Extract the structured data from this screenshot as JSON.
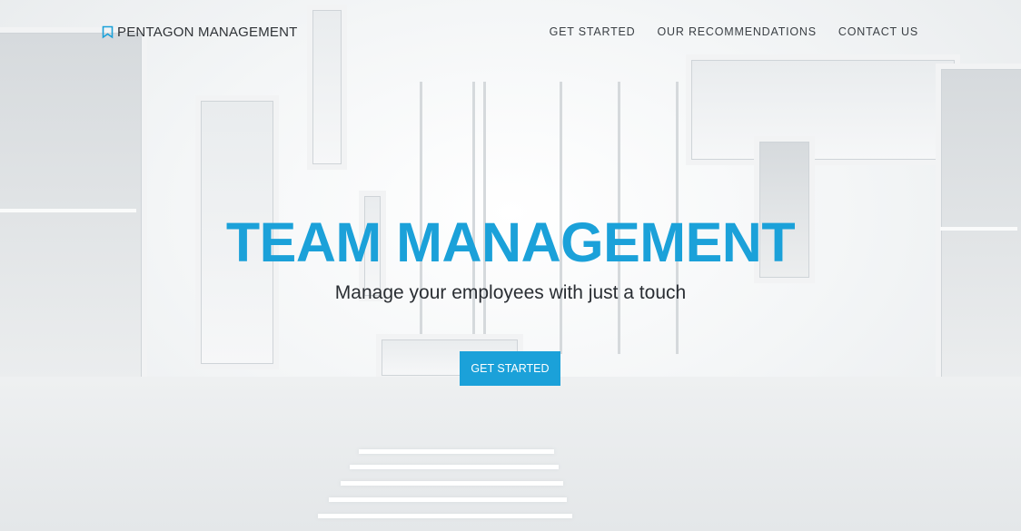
{
  "brand": {
    "name": "PENTAGON MANAGEMENT",
    "icon": "bookmark-icon",
    "accent": "#1ba1d9"
  },
  "nav": {
    "items": [
      "GET STARTED",
      "OUR RECOMMENDATIONS",
      "CONTACT US"
    ]
  },
  "hero": {
    "title": "TEAM MANAGEMENT",
    "subtitle": "Manage your employees with just a touch",
    "cta_label": "GET STARTED"
  }
}
